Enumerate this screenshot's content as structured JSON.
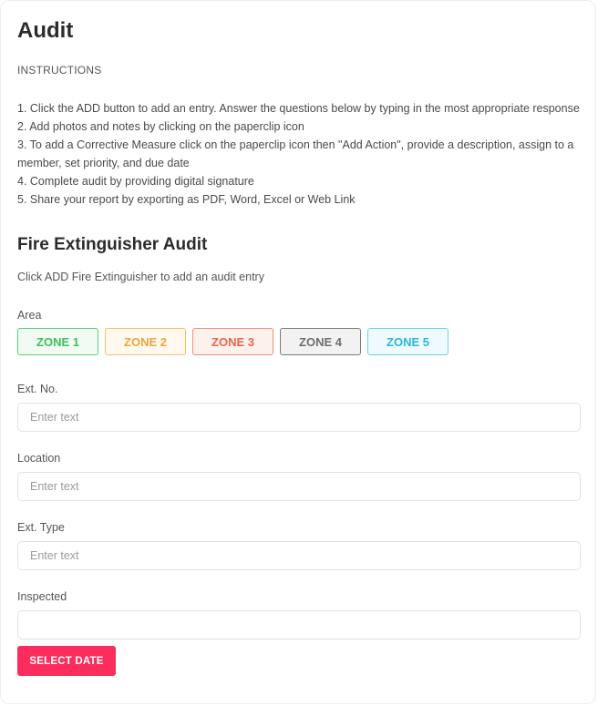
{
  "page": {
    "title": "Audit"
  },
  "instructions": {
    "heading": "INSTRUCTIONS",
    "lines": [
      "1. Click the ADD button to add an entry. Answer the questions below by typing in the most appropriate response",
      "2. Add photos and notes by clicking on the paperclip icon",
      "3. To add a Corrective Measure click on the paperclip icon then \"Add Action\", provide a description, assign to a member, set priority, and due date",
      "4. Complete audit by providing digital signature",
      "5. Share your report by exporting as PDF, Word, Excel or Web Link"
    ]
  },
  "section": {
    "title": "Fire Extinguisher Audit",
    "description": "Click ADD Fire Extinguisher to add an audit entry"
  },
  "area": {
    "label": "Area",
    "zones": [
      {
        "label": "ZONE 1",
        "text_color": "#3cc05c",
        "border_color": "#5ccf74",
        "bg_color": "#f1fbf3"
      },
      {
        "label": "ZONE 2",
        "text_color": "#eea53c",
        "border_color": "#f3bf72",
        "bg_color": "#fff8ee"
      },
      {
        "label": "ZONE 3",
        "text_color": "#e8664a",
        "border_color": "#ee8f7a",
        "bg_color": "#fdf1ee"
      },
      {
        "label": "ZONE 4",
        "text_color": "#6e6e6e",
        "border_color": "#7a7a7a",
        "bg_color": "#f2f2f2"
      },
      {
        "label": "ZONE 5",
        "text_color": "#2bb5dc",
        "border_color": "#6fd0ea",
        "bg_color": "#eefafd"
      }
    ]
  },
  "fields": {
    "ext_no": {
      "label": "Ext. No.",
      "value": "",
      "placeholder": "Enter text"
    },
    "location": {
      "label": "Location",
      "value": "",
      "placeholder": "Enter text"
    },
    "ext_type": {
      "label": "Ext. Type",
      "value": "",
      "placeholder": "Enter text"
    },
    "inspected": {
      "label": "Inspected",
      "value": "",
      "placeholder": ""
    }
  },
  "select_date_button": {
    "label": "SELECT DATE",
    "color": "#fb2d5c"
  }
}
